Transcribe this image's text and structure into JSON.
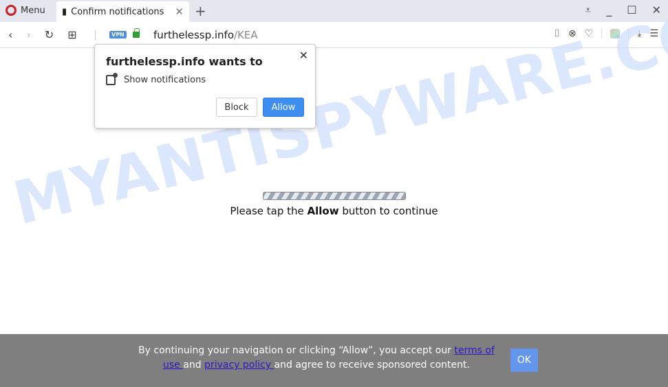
{
  "browser": {
    "menu_label": "Menu",
    "tab_title": "Confirm notifications",
    "url_host": "furthelessp.info",
    "url_path": "/KEA",
    "vpn_badge": "VPN"
  },
  "popup": {
    "title": "furthelessp.info wants to",
    "permission": "Show notifications",
    "block_label": "Block",
    "allow_label": "Allow"
  },
  "page": {
    "progress_state": "indeterminate",
    "msg_before": "Please tap the ",
    "msg_bold": "Allow",
    "msg_after": " button to continue",
    "watermark": "MYANTISPYWARE.COM"
  },
  "cookie": {
    "text1": "By continuing your navigation or clicking “Allow”, you accept our ",
    "terms": "terms of use ",
    "text2": "and ",
    "privacy": "privacy policy ",
    "text3": "and agree to receive sponsored content.",
    "ok_label": "OK"
  },
  "colors": {
    "accent": "#3d8ef0",
    "cookie_bg": "#7f7f7f",
    "ok_bg": "#6495ed",
    "link": "#2a18c8"
  }
}
